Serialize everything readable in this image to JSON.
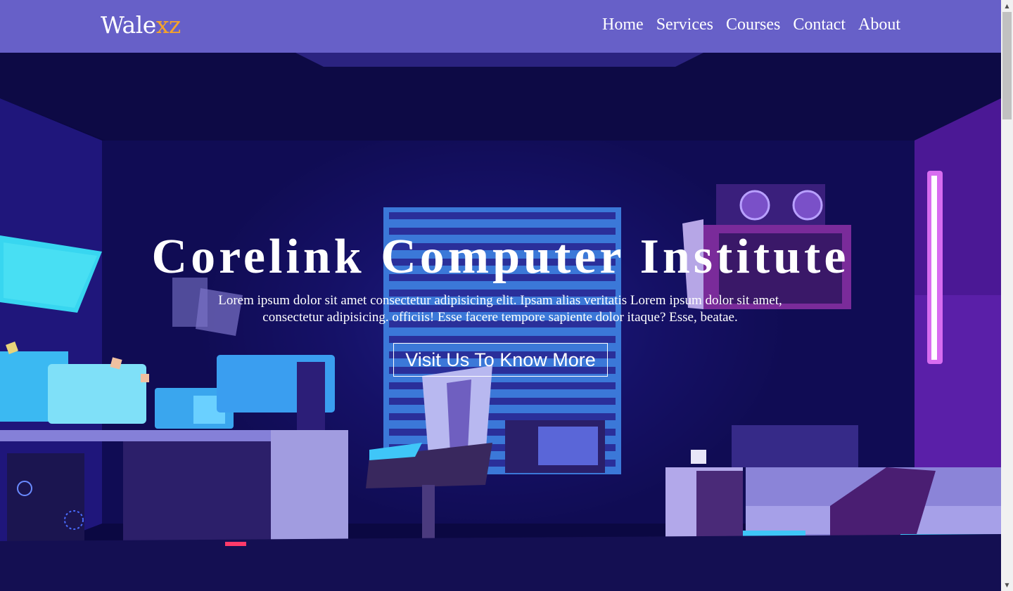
{
  "nav": {
    "brand_main": "Wale",
    "brand_accent": "xz",
    "links": [
      "Home",
      "Services",
      "Courses",
      "Contact",
      "About"
    ]
  },
  "hero": {
    "title": "Corelink Computer Institute",
    "description": "Lorem ipsum dolor sit amet consectetur adipisicing elit. Ipsam alias veritatis Lorem ipsum dolor sit amet, consectetur adipisicing. officiis! Esse facere tempore sapiente dolor itaque? Esse, beatae.",
    "cta_label": "Visit Us To Know More"
  },
  "colors": {
    "navbar": "#6760c8",
    "brand_accent": "#f5a32a",
    "hero_bg": "#0b0842"
  },
  "scrollbar": {
    "up_icon": "▲",
    "down_icon": "▼"
  }
}
